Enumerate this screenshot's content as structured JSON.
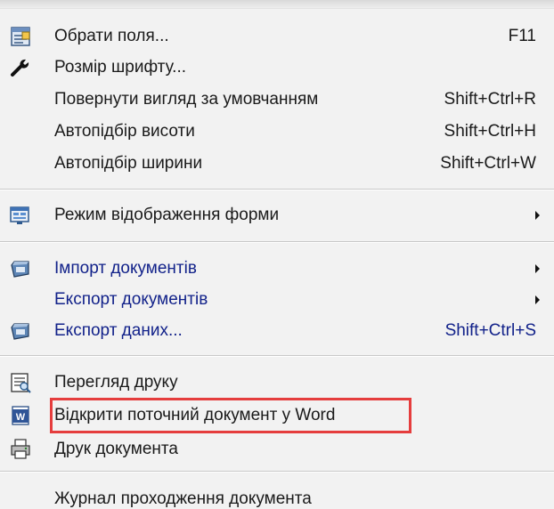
{
  "menu": {
    "items": [
      {
        "icon": "select-fields-icon",
        "label": "Обрати поля...",
        "shortcut": "F11"
      },
      {
        "icon": "wrench-icon",
        "label": "Розмір шрифту..."
      },
      {
        "label": "Повернути вигляд за умовчанням",
        "shortcut": "Shift+Ctrl+R"
      },
      {
        "label": "Автопідбір висоти",
        "shortcut": "Shift+Ctrl+H"
      },
      {
        "label": "Автопідбір ширини",
        "shortcut": "Shift+Ctrl+W"
      },
      {
        "icon": "form-view-icon",
        "label": "Режим відображення форми",
        "submenu": true
      },
      {
        "icon": "import-icon",
        "label": "Імпорт документів",
        "submenu": true,
        "color": "#12228a"
      },
      {
        "label": "Експорт документів",
        "submenu": true,
        "color": "#12228a"
      },
      {
        "icon": "export-icon",
        "label": "Експорт даних...",
        "shortcut": "Shift+Ctrl+S",
        "color": "#12228a"
      },
      {
        "icon": "print-preview-icon",
        "label": "Перегляд друку"
      },
      {
        "icon": "word-icon",
        "label": "Відкрити поточний документ у Word",
        "highlighted": true
      },
      {
        "icon": "printer-icon",
        "label": "Друк документа"
      },
      {
        "label": "Журнал проходження документа"
      }
    ]
  },
  "colors": {
    "highlight_border": "#e53d3d",
    "link_blue": "#12228a"
  }
}
